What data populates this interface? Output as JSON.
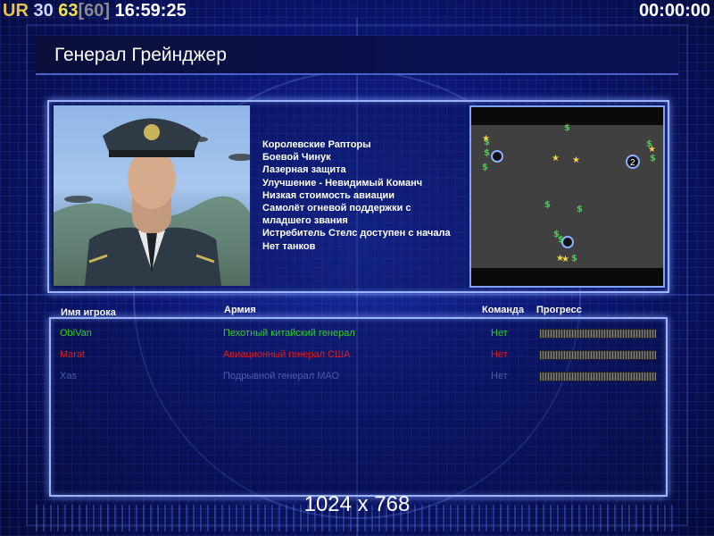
{
  "hud": {
    "rank": "UR",
    "level": "30",
    "fps": "63",
    "fps_limit": "[60]",
    "clock": "16:59:25",
    "timer": "00:00:00"
  },
  "general": {
    "title": "Генерал Грейнджер",
    "bonuses": [
      "Королевские Рапторы",
      "Боевой Чинук",
      "Лазерная защита",
      "Улучшение - Невидимый Команч",
      "Низкая стоимость авиации",
      "Самолёт огневой поддержки с",
      " младшего звания",
      "Истребитель Стелс доступен с начала",
      "Нет танков"
    ]
  },
  "minimap": {
    "marker_label": "2"
  },
  "players": {
    "headers": {
      "name": "Имя игрока",
      "army": "Армия",
      "team": "Команда",
      "progress": "Прогресс"
    },
    "rows": [
      {
        "name": "ObiVan",
        "army": "Пехотный китайский генерал",
        "team": "Нет",
        "color": "#2fcf2a",
        "progress": 1.0
      },
      {
        "name": "Marat",
        "army": "Авиационный генерал США",
        "team": "Нет",
        "color": "#e01c1c",
        "progress": 1.0
      },
      {
        "name": "Xas",
        "army": "Подрывной генерал МАО",
        "team": "Нет",
        "color": "#4a5aa8",
        "progress": 1.0
      }
    ]
  },
  "footer": {
    "resolution": "1024 x 768"
  }
}
